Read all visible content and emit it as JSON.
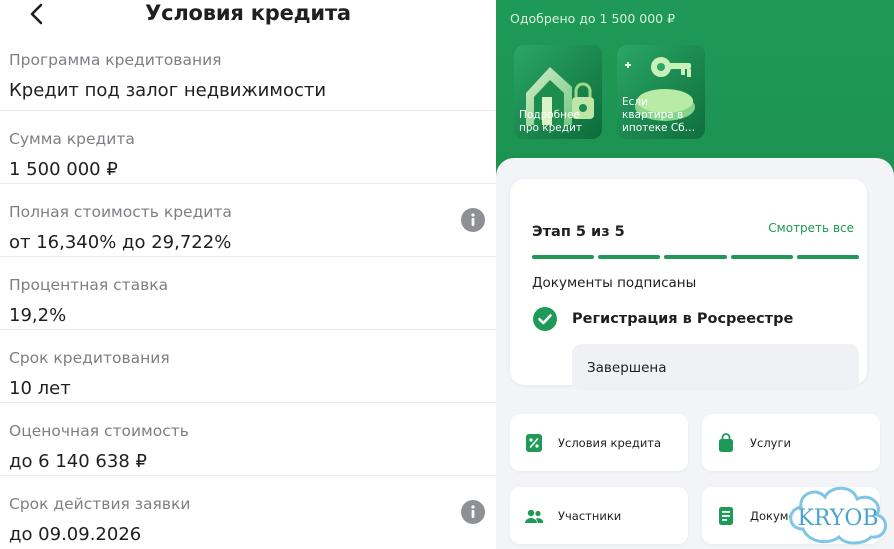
{
  "header": {
    "title": "Условия кредита",
    "back_icon": "chevron-left-icon"
  },
  "conditions": [
    {
      "label": "Программа кредитования",
      "value": "Кредит под залог недвижимости",
      "info": false
    },
    {
      "label": "Сумма кредита",
      "value": "1 500 000 ₽",
      "info": false
    },
    {
      "label": "Полная стоимость кредита",
      "value": "от 16,340% до 29,722%",
      "info": true
    },
    {
      "label": "Процентная ставка",
      "value": "19,2%",
      "info": false
    },
    {
      "label": "Срок кредитования",
      "value": "10 лет",
      "info": false
    },
    {
      "label": "Оценочная стоимость",
      "value": "до 6 140 638 ₽",
      "info": false
    },
    {
      "label": "Срок действия заявки",
      "value": "до 09.09.2026",
      "info": true
    }
  ],
  "right": {
    "approved": "Одобрено до 1 500 000 ₽",
    "stories": [
      {
        "text": "Подробнее про кредит",
        "icon": "house-lock-icon"
      },
      {
        "text": "Если квартира в ипотеке Сб…",
        "icon": "key-icon"
      }
    ],
    "stage": {
      "title": "Этап 5 из 5",
      "see_all": "Смотреть все",
      "segments_done": 5,
      "segments_total": 5,
      "docs_signed": "Документы подписаны",
      "step_title": "Регистрация в Росреестре",
      "step_status": "Завершена"
    },
    "tiles": [
      {
        "label": "Условия кредита",
        "icon": "percent-document-icon"
      },
      {
        "label": "Услуги",
        "icon": "shopping-bag-icon"
      },
      {
        "label": "Участники",
        "icon": "people-icon"
      },
      {
        "label": "Документы",
        "icon": "document-icon"
      }
    ],
    "watermark": "KRYOB"
  },
  "colors": {
    "brand_green": "#1e9a56",
    "text": "#1f1f1f",
    "muted": "#7d7f85"
  }
}
